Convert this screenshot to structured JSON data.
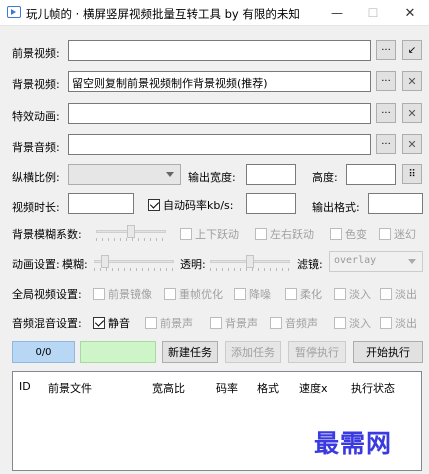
{
  "window": {
    "title": "玩儿帧的 · 横屏竖屏视频批量互转工具  by 有限的未知",
    "min_glyph": "—",
    "max_glyph": "☐",
    "close_glyph": "✕"
  },
  "rows": {
    "foreground_video": {
      "label": "前景视频:",
      "value": ""
    },
    "background_video": {
      "label": "背景视频:",
      "value": "留空则复制前景视频制作背景视频(推荐)"
    },
    "effect_animation": {
      "label": "特效动画:",
      "value": ""
    },
    "background_audio": {
      "label": "背景音频:",
      "value": ""
    }
  },
  "icons": {
    "browse": "···",
    "pick": "↙",
    "clear": "✕",
    "swap": "⠿"
  },
  "size_row": {
    "ratio_label": "纵横比例:",
    "ratio_value": "",
    "width_label": "输出宽度:",
    "width_value": "",
    "height_label": "高度:",
    "height_value": ""
  },
  "duration_row": {
    "duration_label": "视频时长:",
    "duration_value": "",
    "auto_bitrate_label": "自动码率kb/s:",
    "auto_bitrate_checked": true,
    "bitrate_value": "",
    "format_label": "输出格式:",
    "format_value": ""
  },
  "blur_row": {
    "label": "背景模糊系数:",
    "slider_level": 0.5,
    "options": [
      "上下跃动",
      "左右跃动",
      "色变",
      "迷幻"
    ]
  },
  "anim_row": {
    "label": "动画设置:",
    "blur_label": "模糊:",
    "blur_level": 0.1,
    "alpha_label": "透明:",
    "alpha_level": 0.5,
    "filter_label": "滤镜:",
    "filter_value": "overlay"
  },
  "global_row": {
    "label": "全局视频设置:",
    "options": [
      "前景镜像",
      "重帧优化",
      "降噪",
      "柔化",
      "淡入",
      "淡出"
    ]
  },
  "audio_row": {
    "label": "音频混音设置:",
    "mute_label": "静音",
    "mute_checked": true,
    "options": [
      "前景声",
      "背景声",
      "音频声",
      "淡入",
      "淡出"
    ]
  },
  "actions": {
    "progress": "0/0",
    "progress_fraction": 0,
    "new_task": "新建任务",
    "add_task": "添加任务",
    "pause": "暂停执行",
    "start": "开始执行"
  },
  "table": {
    "columns": [
      "ID",
      "前景文件",
      "宽高比",
      "码率",
      "格式",
      "速度x",
      "执行状态"
    ],
    "rows": []
  },
  "watermark": "最需网"
}
